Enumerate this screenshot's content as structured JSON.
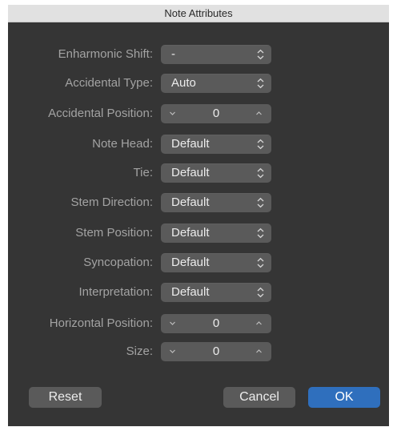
{
  "window": {
    "title": "Note Attributes"
  },
  "fields": [
    {
      "label": "Enharmonic Shift:",
      "kind": "popup",
      "value": "-"
    },
    {
      "label": "Accidental Type:",
      "kind": "popup",
      "value": "Auto"
    },
    {
      "label": "Accidental Position:",
      "kind": "stepper",
      "value": "0"
    },
    {
      "label": "Note Head:",
      "kind": "popup",
      "value": "Default"
    },
    {
      "label": "Tie:",
      "kind": "popup",
      "value": "Default"
    },
    {
      "label": "Stem Direction:",
      "kind": "popup",
      "value": "Default"
    },
    {
      "label": "Stem Position:",
      "kind": "popup",
      "value": "Default"
    },
    {
      "label": "Syncopation:",
      "kind": "popup",
      "value": "Default"
    },
    {
      "label": "Interpretation:",
      "kind": "popup",
      "value": "Default"
    },
    {
      "label": "Horizontal Position:",
      "kind": "stepper",
      "value": "0"
    },
    {
      "label": "Size:",
      "kind": "stepper",
      "value": "0"
    }
  ],
  "buttons": {
    "reset": "Reset",
    "cancel": "Cancel",
    "ok": "OK"
  },
  "icons": {
    "popup": "up-down-chevron-icon",
    "decrement": "chevron-down-icon",
    "increment": "chevron-up-icon"
  },
  "colors": {
    "background": "#353535",
    "control": "#5a5a5a",
    "label": "#a3a3a3",
    "accent": "#2f6fbd"
  }
}
